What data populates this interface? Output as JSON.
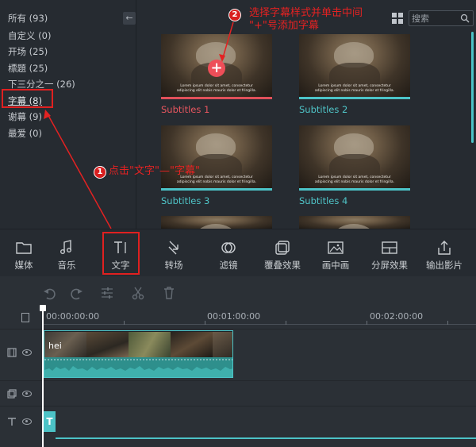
{
  "categories": [
    {
      "label": "所有 (93)"
    },
    {
      "label": "自定义 (0)"
    },
    {
      "label": "开场 (25)"
    },
    {
      "label": "標題 (25)"
    },
    {
      "label": "下三分之一 (26)"
    },
    {
      "label": "字幕 (8)"
    },
    {
      "label": "谢幕 (9)"
    },
    {
      "label": "最爱 (0)"
    }
  ],
  "collapse_icon": "arrow-left-icon",
  "search": {
    "placeholder": "搜索",
    "icon": "search-icon"
  },
  "view_icon": "grid-view-icon",
  "thumbnails": [
    {
      "title": "Subtitles 1",
      "caption": "Lorem ipsum dolor sit amet, consectetur adipiscing elit nobis mauris dolor et fringilla.",
      "selected": true
    },
    {
      "title": "Subtitles 2",
      "caption": "Lorem ipsum dolor sit amet, consectetur adipiscing elit nobis mauris dolor et fringilla.",
      "selected": false
    },
    {
      "title": "Subtitles 3",
      "caption": "Lorem ipsum dolor sit amet, consectetur adipiscing elit nobis mauris dolor et fringilla.",
      "selected": false
    },
    {
      "title": "Subtitles 4",
      "caption": "Lorem ipsum dolor sit amet, consectetur adipiscing elit nobis mauris dolor et fringilla.",
      "selected": false
    }
  ],
  "add_button": "+",
  "annotations": [
    {
      "number": "1",
      "text": "点击\"文字\"—\"字幕\""
    },
    {
      "number": "2",
      "line1": "选择字幕样式并单击中间",
      "line2": "\"+\"号添加字幕"
    }
  ],
  "toolbar": [
    {
      "label": "媒体",
      "icon": "folder-icon"
    },
    {
      "label": "音乐",
      "icon": "music-note-icon"
    },
    {
      "label": "文字",
      "icon": "text-cursor-icon"
    },
    {
      "label": "转场",
      "icon": "transition-icon"
    },
    {
      "label": "滤镜",
      "icon": "filter-icon"
    },
    {
      "label": "覆叠效果",
      "icon": "overlay-icon"
    },
    {
      "label": "画中画",
      "icon": "picture-in-picture-icon"
    },
    {
      "label": "分屏效果",
      "icon": "split-screen-icon"
    },
    {
      "label": "输出影片",
      "icon": "export-icon"
    }
  ],
  "edit_tools": [
    "undo-icon",
    "redo-icon",
    "adjust-icon",
    "cut-icon",
    "delete-icon"
  ],
  "timecodes": [
    "00:00:00:00",
    "00:01:00:00",
    "00:02:00:00"
  ],
  "tracks": {
    "video": {
      "icon": "film-icon",
      "clip_label": "hei"
    },
    "overlay": {
      "icon": "overlay-track-icon"
    },
    "text": {
      "icon": "text-track-icon",
      "clip_label": "T"
    }
  },
  "colors": {
    "accent": "#4cc3c7",
    "selected": "#e7565f",
    "annotation": "#e42222"
  }
}
